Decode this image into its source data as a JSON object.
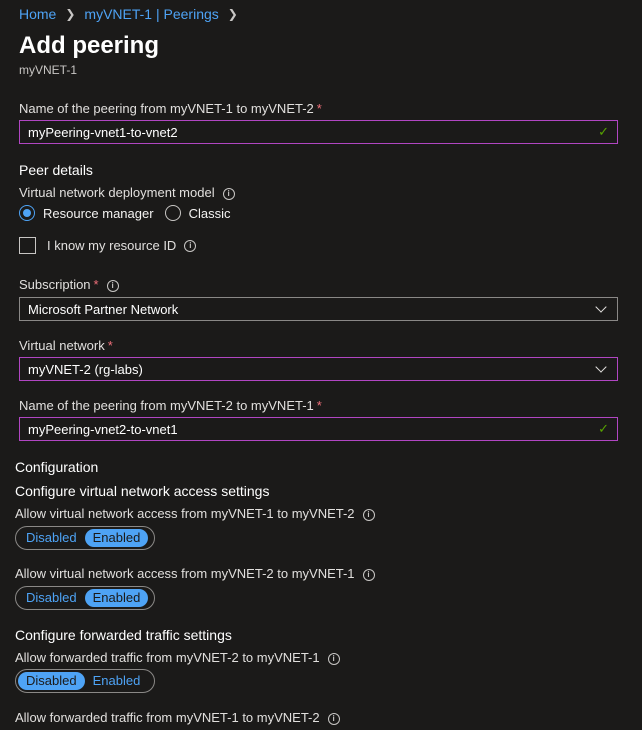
{
  "breadcrumb": {
    "items": [
      "Home",
      "myVNET-1 | Peerings"
    ]
  },
  "page": {
    "title": "Add peering",
    "subtitle": "myVNET-1"
  },
  "peering1": {
    "label": "Name of the peering from myVNET-1 to myVNET-2",
    "value": "myPeering-vnet1-to-vnet2"
  },
  "peer_details": {
    "heading": "Peer details",
    "deployment_label": "Virtual network deployment model",
    "options": [
      "Resource manager",
      "Classic"
    ],
    "selected": "Resource manager",
    "know_resource_id": "I know my resource ID"
  },
  "subscription": {
    "label": "Subscription",
    "value": "Microsoft Partner Network"
  },
  "virtual_network": {
    "label": "Virtual network",
    "value": "myVNET-2 (rg-labs)"
  },
  "peering2": {
    "label": "Name of the peering from myVNET-2 to myVNET-1",
    "value": "myPeering-vnet2-to-vnet1"
  },
  "configuration": {
    "heading": "Configuration",
    "access_heading": "Configure virtual network access settings",
    "access1_label": "Allow virtual network access from myVNET-1 to myVNET-2",
    "access2_label": "Allow virtual network access from myVNET-2 to myVNET-1",
    "forward_heading": "Configure forwarded traffic settings",
    "forward1_label": "Allow forwarded traffic from myVNET-2 to myVNET-1",
    "forward2_label": "Allow forwarded traffic from myVNET-1 to myVNET-2",
    "toggle_disabled": "Disabled",
    "toggle_enabled": "Enabled",
    "access1_state": "Enabled",
    "access2_state": "Enabled",
    "forward1_state": "Disabled"
  },
  "colors": {
    "accent": "#4ea3f5",
    "required": "#f1707b",
    "valid": "#57a300",
    "focus_border": "#b146c2"
  }
}
